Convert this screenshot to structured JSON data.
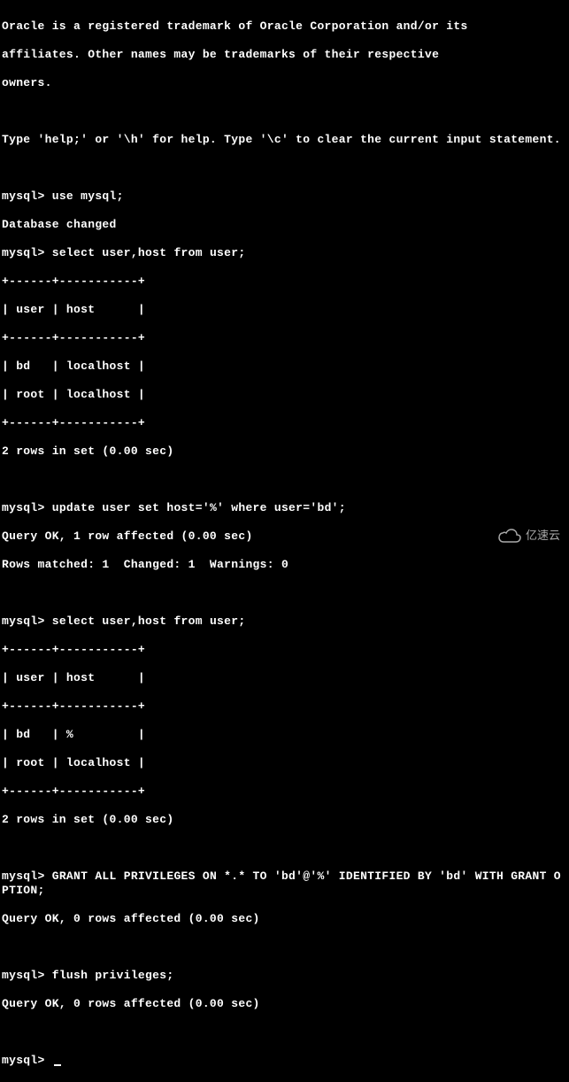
{
  "intro": {
    "trademark1": "Oracle is a registered trademark of Oracle Corporation and/or its",
    "trademark2": "affiliates. Other names may be trademarks of their respective",
    "trademark3": "owners.",
    "help": "Type 'help;' or '\\h' for help. Type '\\c' to clear the current input statement."
  },
  "block1": {
    "prompt": "mysql> ",
    "cmd1": "use mysql;",
    "resp1": "Database changed",
    "cmd2": "select user,host from user;",
    "border": "+------+-----------+",
    "header": "| user | host      |",
    "row1": "| bd   | localhost |",
    "row2": "| root | localhost |",
    "summary": "2 rows in set (0.00 sec)"
  },
  "block2": {
    "cmd": "update user set host='%' where user='bd';",
    "resp1": "Query OK, 1 row affected (0.00 sec)",
    "resp2": "Rows matched: 1  Changed: 1  Warnings: 0"
  },
  "block3": {
    "cmd": "select user,host from user;",
    "border": "+------+-----------+",
    "header": "| user | host      |",
    "row1": "| bd   | %         |",
    "row2": "| root | localhost |",
    "summary": "2 rows in set (0.00 sec)"
  },
  "block4": {
    "cmd": "GRANT ALL PRIVILEGES ON *.* TO 'bd'@'%' IDENTIFIED BY 'bd' WITH GRANT OPTION;",
    "resp": "Query OK, 0 rows affected (0.00 sec)"
  },
  "block5": {
    "cmd": "flush privileges;",
    "resp": "Query OK, 0 rows affected (0.00 sec)"
  },
  "final_prompt": "mysql> ",
  "watermark": {
    "text": "亿速云"
  }
}
